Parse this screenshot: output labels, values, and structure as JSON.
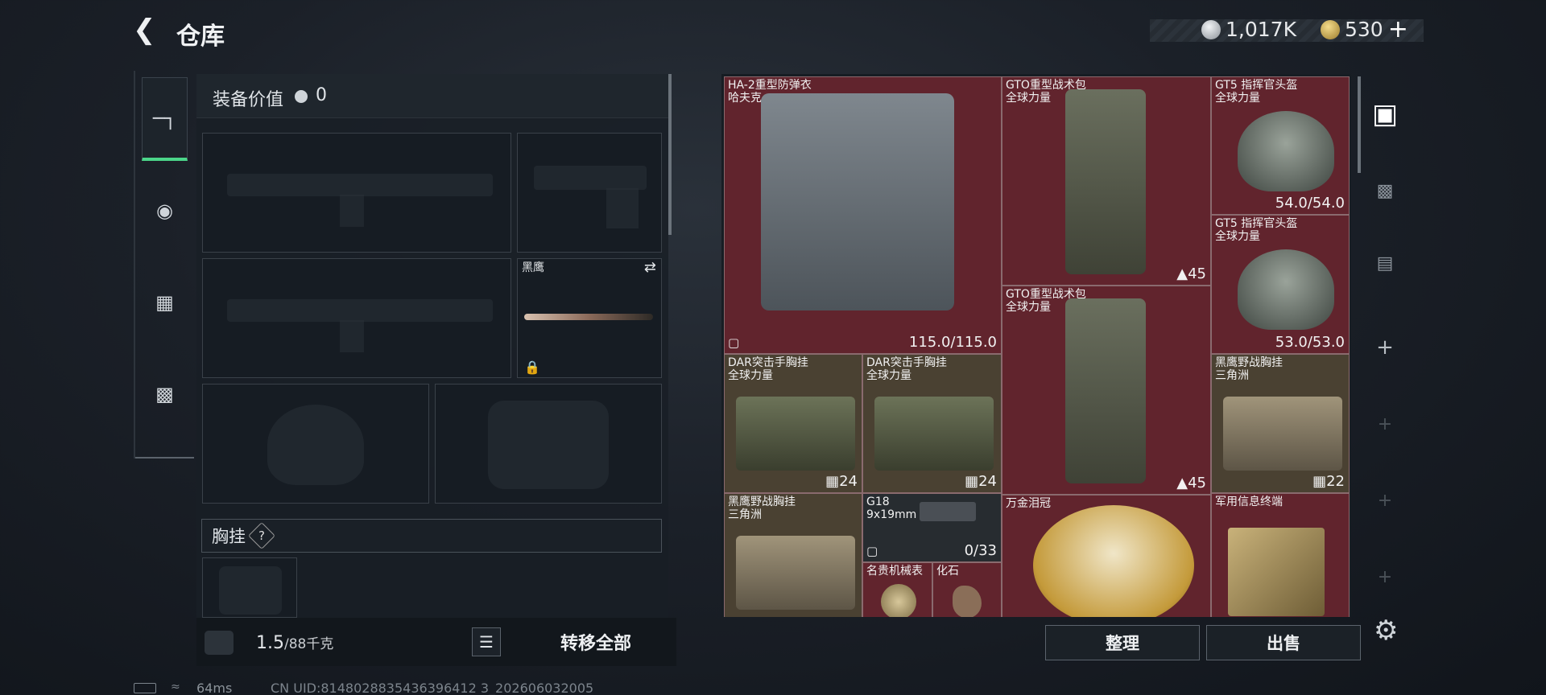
{
  "header": {
    "title": "仓库",
    "silver": "1,017K",
    "gold": "530",
    "add_symbol": "+"
  },
  "equipment": {
    "value_label": "装备价值",
    "value": "0",
    "melee_name": "黑鹰",
    "vest_label": "胸挂",
    "help": "?",
    "weight_current": "1.5",
    "weight_max": "/88千克",
    "transfer_label": "转移全部"
  },
  "stash": {
    "items": [
      {
        "name": "HA-2重型防弹衣",
        "sub": "哈夫克",
        "stat": "115.0/115.0"
      },
      {
        "name": "GTO重型战术包",
        "sub": "全球力量",
        "stat": "45"
      },
      {
        "name": "GT5 指挥官头盔",
        "sub": "全球力量",
        "stat": "54.0/54.0"
      },
      {
        "name": "GT5 指挥官头盔",
        "sub": "全球力量",
        "stat": "53.0/53.0"
      },
      {
        "name": "GTO重型战术包",
        "sub": "全球力量",
        "stat": "45"
      },
      {
        "name": "DAR突击手胸挂",
        "sub": "全球力量",
        "stat": "24"
      },
      {
        "name": "DAR突击手胸挂",
        "sub": "全球力量",
        "stat": "24"
      },
      {
        "name": "黑鹰野战胸挂",
        "sub": "三角洲",
        "stat": "22"
      },
      {
        "name": "黑鹰野战胸挂",
        "sub": "三角洲",
        "stat": ""
      },
      {
        "name": "G18",
        "sub": "9x19mm",
        "stat": "0/33"
      },
      {
        "name": "万金泪冠",
        "sub": "",
        "stat": ""
      },
      {
        "name": "军用信息终端",
        "sub": "",
        "stat": ""
      },
      {
        "name": "名贵机械表",
        "sub": "",
        "stat": ""
      },
      {
        "name": "化石",
        "sub": "",
        "stat": ""
      }
    ],
    "sort_label": "整理",
    "sell_label": "出售"
  },
  "status": {
    "ping": "64ms",
    "uid": "CN UID:8148028835436396412 3_202606032005"
  }
}
